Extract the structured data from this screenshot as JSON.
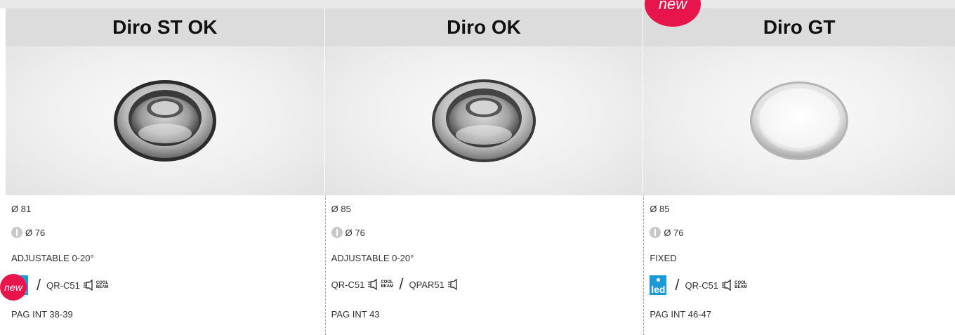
{
  "columns": [
    {
      "title": "Diro ST OK",
      "diameter": "Ø 81",
      "hole": "Ø 76",
      "mount": "ADJUSTABLE 0-20°",
      "lamp_a": "QR-C51",
      "lamp_b": "",
      "page": "PAG INT 38-39"
    },
    {
      "title": "Diro OK",
      "diameter": "Ø 85",
      "hole": "Ø 76",
      "mount": "ADJUSTABLE 0-20°",
      "lamp_a": "QR-C51",
      "lamp_b": "QPAR51",
      "page": "PAG INT 43"
    },
    {
      "title": "Diro GT",
      "diameter": "Ø 85",
      "hole": "Ø 76",
      "mount": "FIXED",
      "lamp_a": "QR-C51",
      "lamp_b": "",
      "page": "PAG INT 46-47"
    }
  ],
  "badges": {
    "new": "new",
    "led": "led",
    "cool_beam": "COOL BEAM",
    "slash": "/"
  },
  "colors": {
    "badge_red": "#e8154c",
    "led_blue": "#1a9ad6",
    "header_gray": "#dcdcdc"
  },
  "icons": [
    "hole-cut-icon",
    "led-icon",
    "lamp-icon",
    "cool-beam-icon",
    "new-badge"
  ]
}
